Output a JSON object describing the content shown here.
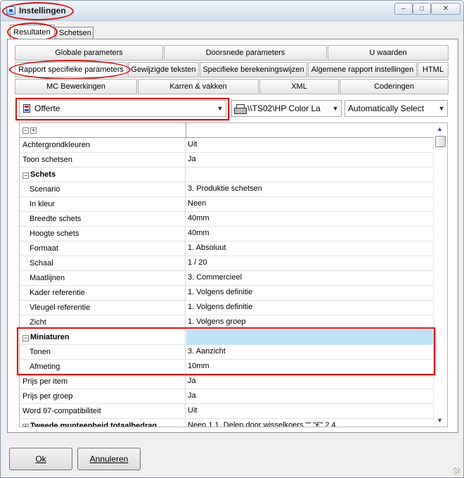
{
  "window": {
    "title": "Instellingen"
  },
  "title_controls": {
    "minimize": "‒",
    "maximize": "□",
    "close": "✕"
  },
  "outer_tabs": [
    {
      "label": "Resultaten",
      "active": true
    },
    {
      "label": "Schetsen",
      "active": false
    }
  ],
  "tab_rows": [
    [
      "Globale parameters",
      "Doorsnede parameters",
      "U waarden"
    ],
    [
      "Rapport specifieke parameters",
      "Gewijzigde teksten",
      "Specifieke berekeningswijzen",
      "Algemene rapport instellingen",
      "HTML"
    ],
    [
      "MC Bewerkingen",
      "Karren & vakken",
      "XML",
      "Coderingen"
    ]
  ],
  "report_select": {
    "value": "Offerte",
    "icon": "report-icon"
  },
  "printer_select": {
    "value": "\\\\TS02\\HP Color La",
    "icon": "printer-icon"
  },
  "mode_select": {
    "value": "Automatically Select"
  },
  "grid": {
    "header_controls": [
      "−",
      "+"
    ],
    "rows": [
      {
        "key": "Achtergrondkleuren",
        "value": "Uit",
        "indent": false,
        "section": false
      },
      {
        "key": "Toon schetsen",
        "value": "Ja",
        "indent": false,
        "section": false
      },
      {
        "key": "Schets",
        "value": "",
        "indent": false,
        "section": true,
        "expander": "−"
      },
      {
        "key": "Scenario",
        "value": "3. Produktie schetsen",
        "indent": true,
        "section": false
      },
      {
        "key": "In kleur",
        "value": "Neen",
        "indent": true,
        "section": false
      },
      {
        "key": "Breedte schets",
        "value": "40mm",
        "indent": true,
        "section": false
      },
      {
        "key": "Hoogte schets",
        "value": "40mm",
        "indent": true,
        "section": false
      },
      {
        "key": "Formaat",
        "value": "1. Absoluut",
        "indent": true,
        "section": false
      },
      {
        "key": "Schaal",
        "value": "1 / 20",
        "indent": true,
        "section": false
      },
      {
        "key": "Maatlijnen",
        "value": "3. Commercieel",
        "indent": true,
        "section": false
      },
      {
        "key": "Kader referentie",
        "value": "1. Volgens definitie",
        "indent": true,
        "section": false
      },
      {
        "key": "Vleugel referentie",
        "value": "1. Volgens definitie",
        "indent": true,
        "section": false
      },
      {
        "key": "Zicht",
        "value": "1. Volgens groep",
        "indent": true,
        "section": false
      },
      {
        "key": "Miniaturen",
        "value": "",
        "indent": false,
        "section": true,
        "expander": "−",
        "highlight": true
      },
      {
        "key": "Tonen",
        "value": "3. Aanzicht",
        "indent": true,
        "section": false
      },
      {
        "key": "Afmeting",
        "value": "10mm",
        "indent": true,
        "section": false
      },
      {
        "key": "Prijs per item",
        "value": "Ja",
        "indent": false,
        "section": false
      },
      {
        "key": "Prijs per groep",
        "value": "Ja",
        "indent": false,
        "section": false
      },
      {
        "key": "Word 97-compatibiliteit",
        "value": "Uit",
        "indent": false,
        "section": false
      },
      {
        "key": "Tweede munteenheid totaalbedrag",
        "value": "Neen 1.1. Delen door wisselkoers \"\" \"€\" 2.4",
        "indent": false,
        "section": true,
        "expander": "+"
      }
    ]
  },
  "buttons": {
    "ok": "Ok",
    "cancel": "Annuleren"
  },
  "colors": {
    "annotation_red": "#d01818",
    "highlight_blue": "#bfe3f7"
  }
}
